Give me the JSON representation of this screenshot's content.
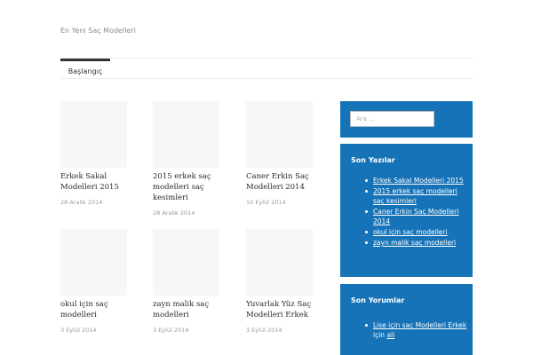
{
  "site": {
    "tagline": "En Yeni Saç Modelleri"
  },
  "nav": {
    "items": [
      {
        "label": "Başlangıç"
      }
    ]
  },
  "posts": [
    {
      "title": "Erkek Sakal Modelleri 2015",
      "date": "28 Aralık 2014"
    },
    {
      "title": "2015 erkek saç modelleri saç kesimleri",
      "date": "28 Aralık 2014"
    },
    {
      "title": "Caner Erkin Saç Modelleri 2014",
      "date": "10 Eylül 2014"
    },
    {
      "title": "okul için saç modelleri",
      "date": "3 Eylül 2014"
    },
    {
      "title": "zayn malik saç modelleri",
      "date": "3 Eylül 2014"
    },
    {
      "title": "Yuvarlak Yüz Saç Modelleri Erkek",
      "date": "3 Eylül 2014"
    }
  ],
  "sidebar": {
    "search": {
      "placeholder": "Ara …"
    },
    "recent_posts": {
      "title": "Son Yazılar",
      "items": [
        "Erkek Sakal Modelleri 2015",
        "2015 erkek saç modelleri saç kesimleri",
        "Caner Erkin Saç Modelleri 2014",
        "okul için saç modelleri",
        "zayn malik saç modelleri"
      ]
    },
    "recent_comments": {
      "title": "Son Yorumlar",
      "items": [
        {
          "author": "Lise için saç Modelleri Erkek",
          "connector": "için",
          "post": "ali"
        }
      ]
    }
  }
}
